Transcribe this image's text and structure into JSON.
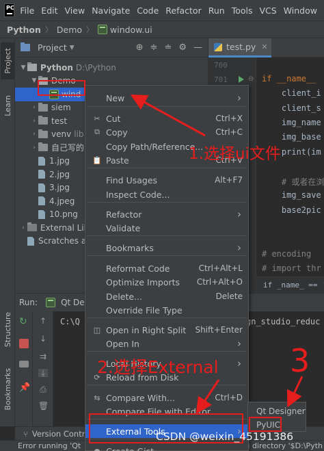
{
  "menubar": {
    "items": [
      "File",
      "Edit",
      "View",
      "Navigate",
      "Code",
      "Refactor",
      "Run",
      "Tools",
      "VCS",
      "Window"
    ]
  },
  "breadcrumb": {
    "project": "Python",
    "folder": "Demo",
    "file": "window.ui"
  },
  "left_strip": {
    "project": "Project",
    "learn": "Learn",
    "structure": "Structure",
    "bookmarks": "Bookmarks"
  },
  "project_panel": {
    "title": "Project",
    "tree": [
      {
        "label": "Python",
        "extra": "D:\\Python",
        "kind": "folder-open"
      },
      {
        "label": "Demo",
        "extra": "",
        "kind": "folder-open"
      },
      {
        "label": "wind",
        "extra": "",
        "kind": "ui-file"
      },
      {
        "label": "siem",
        "extra": "",
        "kind": "folder"
      },
      {
        "label": "test",
        "extra": "",
        "kind": "folder"
      },
      {
        "label": "venv",
        "extra": "lib",
        "kind": "folder"
      },
      {
        "label": "自己写的",
        "extra": "",
        "kind": "folder"
      },
      {
        "label": "1.jpg",
        "extra": "",
        "kind": "file"
      },
      {
        "label": "2.jpg",
        "extra": "",
        "kind": "file"
      },
      {
        "label": "3.jpg",
        "extra": "",
        "kind": "file"
      },
      {
        "label": "4.jpeg",
        "extra": "",
        "kind": "file"
      },
      {
        "label": "10.png",
        "extra": "",
        "kind": "file"
      },
      {
        "label": "External Lib",
        "extra": "",
        "kind": "lib"
      },
      {
        "label": "Scratches a",
        "extra": "",
        "kind": "scratch"
      }
    ]
  },
  "editor": {
    "tab_label": "test.py",
    "line_numbers": [
      "700",
      "701"
    ],
    "code_lines": [
      "if __name__",
      "    client_i",
      "    client_s",
      "    img_name",
      "    img_base",
      "    print(im",
      "",
      "    # 或者在浏",
      "    img_save",
      "    base2pic",
      "",
      "",
      "# encoding",
      "# import thr"
    ],
    "bottom_crumb": "if _name_ == '"
  },
  "run_panel": {
    "label": "Run:",
    "tab": "Qt Des",
    "console_line_1": "C:\\Q",
    "console_line_2": "gn_studio_reduc"
  },
  "bottom_tools": {
    "version_control": "Version Contro"
  },
  "status": {
    "text": "Error running 'Qt",
    "right": "g directory '$D:\\Pyth"
  },
  "context_menu": {
    "items": [
      {
        "label": "New",
        "shortcut": "",
        "submenu": true,
        "icon": ""
      },
      {
        "label": "Cut",
        "shortcut": "Ctrl+X",
        "submenu": false,
        "icon": "scissors"
      },
      {
        "label": "Copy",
        "shortcut": "Ctrl+C",
        "submenu": false,
        "icon": "copy"
      },
      {
        "label": "Copy Path/Reference...",
        "shortcut": "",
        "submenu": false,
        "icon": ""
      },
      {
        "label": "Paste",
        "shortcut": "Ctrl+V",
        "submenu": false,
        "icon": "paste"
      },
      {
        "label": "Find Usages",
        "shortcut": "Alt+F7",
        "submenu": false,
        "icon": ""
      },
      {
        "label": "Inspect Code...",
        "shortcut": "",
        "submenu": false,
        "icon": ""
      },
      {
        "label": "Refactor",
        "shortcut": "",
        "submenu": true,
        "icon": ""
      },
      {
        "label": "Validate",
        "shortcut": "",
        "submenu": false,
        "icon": ""
      },
      {
        "label": "Bookmarks",
        "shortcut": "",
        "submenu": true,
        "icon": ""
      },
      {
        "label": "Reformat Code",
        "shortcut": "Ctrl+Alt+L",
        "submenu": false,
        "icon": ""
      },
      {
        "label": "Optimize Imports",
        "shortcut": "Ctrl+Alt+O",
        "submenu": false,
        "icon": ""
      },
      {
        "label": "Delete...",
        "shortcut": "Delete",
        "submenu": false,
        "icon": ""
      },
      {
        "label": "Override File Type",
        "shortcut": "",
        "submenu": false,
        "icon": ""
      },
      {
        "label": "Open in Right Split",
        "shortcut": "Shift+Enter",
        "submenu": false,
        "icon": "split"
      },
      {
        "label": "Open In",
        "shortcut": "",
        "submenu": true,
        "icon": ""
      },
      {
        "label": "Local History",
        "shortcut": "",
        "submenu": true,
        "icon": ""
      },
      {
        "label": "Reload from Disk",
        "shortcut": "",
        "submenu": false,
        "icon": "reload"
      },
      {
        "label": "Compare With...",
        "shortcut": "Ctrl+D",
        "submenu": false,
        "icon": "compare"
      },
      {
        "label": "Compare File with Editor",
        "shortcut": "",
        "submenu": false,
        "icon": ""
      },
      {
        "label": "External Tools",
        "shortcut": "",
        "submenu": true,
        "icon": ""
      },
      {
        "label": "Create Gist...",
        "shortcut": "",
        "submenu": false,
        "icon": "github"
      }
    ]
  },
  "submenu": {
    "items": [
      "Qt Designer",
      "PyUIC"
    ]
  },
  "annotations": {
    "step1": "1.选择ui文件",
    "step2": "2.选择External",
    "step3": "3"
  },
  "watermark": "CSDN @weixin_45191386",
  "colors": {
    "annotation": "#e51d1d",
    "selection": "#2f65ca",
    "panel": "#3c3f41",
    "editor": "#2b2b2b"
  }
}
